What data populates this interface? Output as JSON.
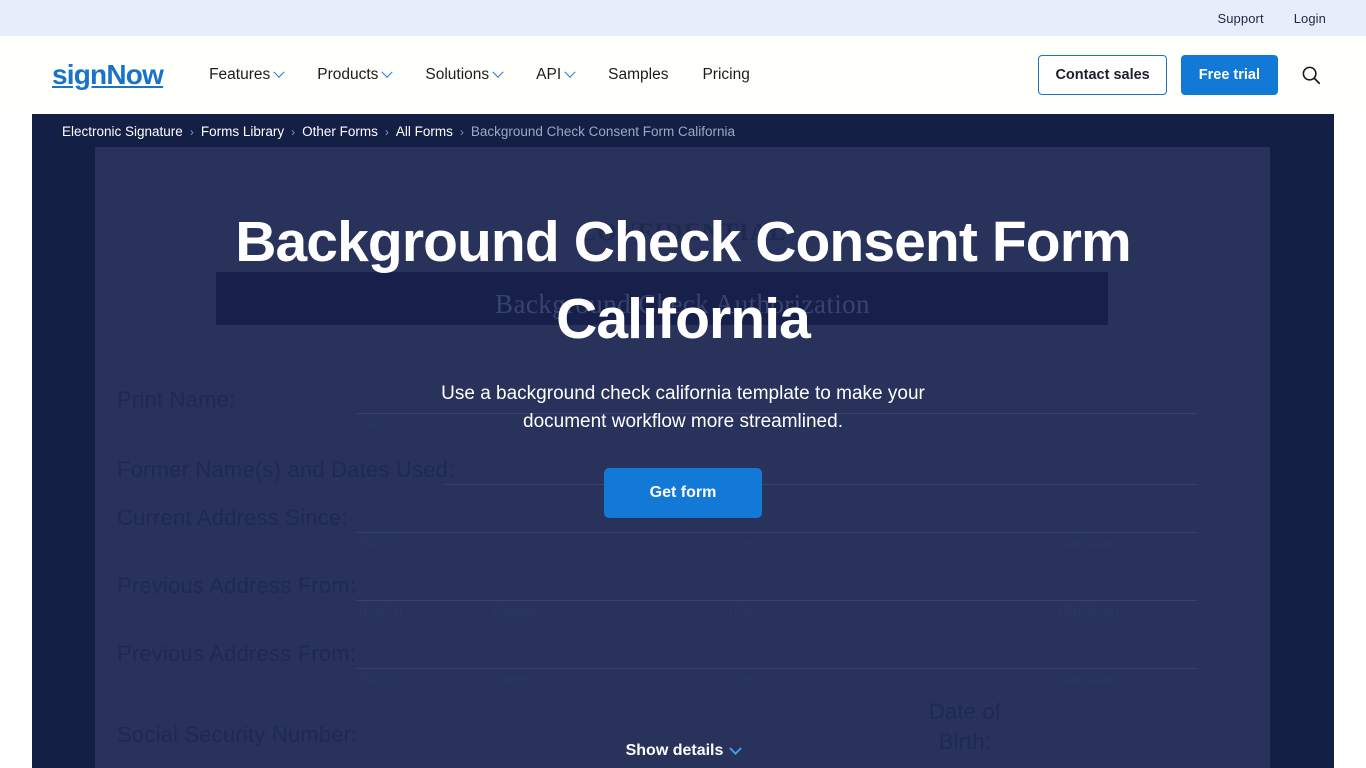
{
  "utility_bar": {
    "links": [
      {
        "label": "Support"
      },
      {
        "label": "Login"
      }
    ]
  },
  "header": {
    "logo": "signNow",
    "nav": [
      {
        "label": "Features",
        "has_dropdown": true
      },
      {
        "label": "Products",
        "has_dropdown": true
      },
      {
        "label": "Solutions",
        "has_dropdown": true
      },
      {
        "label": "API",
        "has_dropdown": true
      },
      {
        "label": "Samples",
        "has_dropdown": false
      },
      {
        "label": "Pricing",
        "has_dropdown": false
      }
    ],
    "contact_sales_label": "Contact sales",
    "free_trial_label": "Free trial",
    "search_icon": "search-icon"
  },
  "breadcrumb": {
    "separator": "›",
    "items": [
      {
        "label": "Electronic Signature",
        "current": false
      },
      {
        "label": "Forms Library",
        "current": false
      },
      {
        "label": "Other Forms",
        "current": false
      },
      {
        "label": "All Forms",
        "current": false
      },
      {
        "label": "Background Check Consent Form California",
        "current": true
      }
    ]
  },
  "hero": {
    "title": "Background Check Consent Form California",
    "subtitle": "Use a background check california template to make your document workflow more streamlined.",
    "cta_label": "Get form",
    "show_details_label": "Show details",
    "show_details_icon": "chevron-down-icon"
  },
  "document_preview": {
    "confidential": "CONFIDENTIAL",
    "banner_title": "Background Check Authorization",
    "fields": [
      {
        "label": "Print Name:"
      },
      {
        "label": "Former Name(s) and Dates Used:"
      },
      {
        "label": "Current Address Since:"
      },
      {
        "label": "Previous Address From:"
      },
      {
        "label": "Previous Address From:"
      },
      {
        "label": "Social Security Number:"
      },
      {
        "label": "Date of Birth:"
      }
    ],
    "sublabels": {
      "first": "(First)",
      "moyr": "(Mo/Yr)",
      "street": "(Street)",
      "city": "(City)",
      "zipstate": "(Zip/State)"
    }
  },
  "colors": {
    "brand_blue": "#1379d6",
    "logo_blue": "#1a73c8",
    "hero_navy": "#141f45",
    "doc_navy": "#28325b",
    "utility_bar": "#e8edfb"
  }
}
